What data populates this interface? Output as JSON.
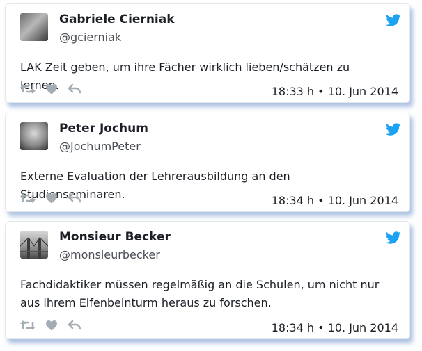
{
  "tweets": [
    {
      "name": "Gabriele Cierniak",
      "handle": "@gcierniak",
      "text": "LAK Zeit geben, um ihre Fächer wirklich lieben/schätzen zu lernen.",
      "timestamp": "18:33 h • 10. Jun 2014",
      "avatar": "avatar-photo-gabriele"
    },
    {
      "name": "Peter Jochum",
      "handle": "@JochumPeter",
      "text": "Externe Evaluation der Lehrerausbildung an den Studienseminaren.",
      "timestamp": "18:34 h • 10. Jun 2014",
      "avatar": "avatar-photo-peter"
    },
    {
      "name": "Monsieur Becker",
      "handle": "@monsieurbecker",
      "text": "Fachdidaktiker müssen regelmäßig an die Schulen, um nicht nur aus ihrem Elfenbeinturm heraus zu forschen.",
      "timestamp": "18:34 h • 10. Jun 2014",
      "avatar": "avatar-photo-bridge"
    }
  ],
  "colors": {
    "twitter_blue": "#1da1f2",
    "action_gray": "#a4acb4",
    "card_shadow": "#4678be"
  },
  "icons": {
    "brand": "twitter-bird-icon",
    "actions": [
      "retweet-icon",
      "like-icon",
      "reply-icon"
    ]
  }
}
